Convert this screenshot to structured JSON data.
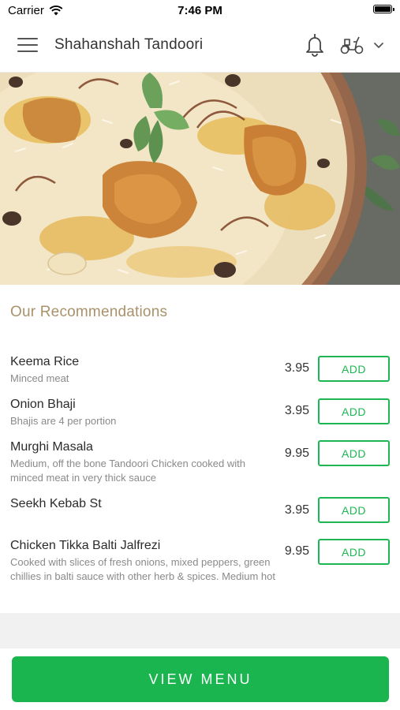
{
  "status_bar": {
    "carrier": "Carrier",
    "time": "7:46 PM"
  },
  "header": {
    "title": "Shahanshah Tandoori"
  },
  "section": {
    "title": "Our Recommendations"
  },
  "items": [
    {
      "name": "Keema Rice",
      "description": "Minced meat",
      "price": "3.95",
      "add_label": "ADD"
    },
    {
      "name": "Onion Bhaji",
      "description": "Bhajis are 4 per portion",
      "price": "3.95",
      "add_label": "ADD"
    },
    {
      "name": "Murghi Masala",
      "description": "Medium, off the bone Tandoori Chicken cooked with minced meat in very thick sauce",
      "price": "9.95",
      "add_label": "ADD"
    },
    {
      "name": "Seekh Kebab St",
      "description": "",
      "price": "3.95",
      "add_label": "ADD"
    },
    {
      "name": "Chicken Tikka Balti Jalfrezi",
      "description": "Cooked with slices of fresh onions, mixed peppers, green chillies in balti sauce with other herb & spices. Medium hot",
      "price": "9.95",
      "add_label": "ADD"
    }
  ],
  "footer": {
    "view_menu_label": "VIEW MENU"
  },
  "colors": {
    "accent": "#1db653",
    "section_title": "#a8926b"
  },
  "icons": [
    "wifi-icon",
    "battery-icon",
    "menu-icon",
    "bell-icon",
    "scooter-icon",
    "chevron-down-icon"
  ]
}
